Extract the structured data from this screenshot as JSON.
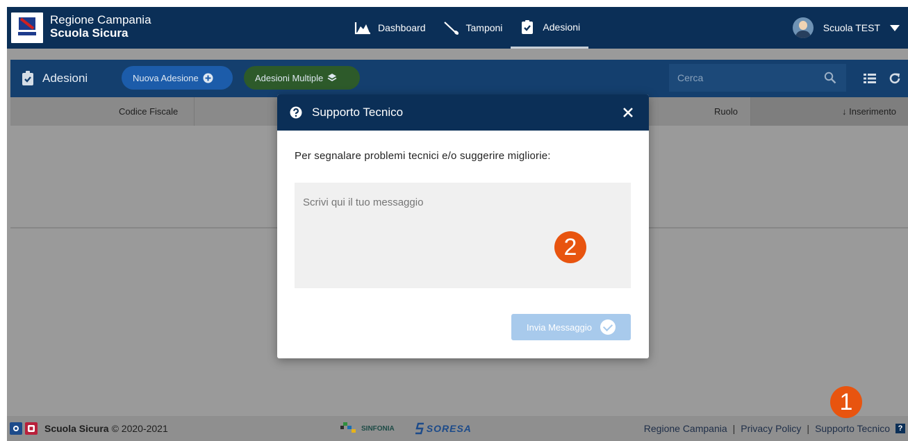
{
  "app": {
    "region": "Regione Campania",
    "name": "Scuola Sicura"
  },
  "nav": [
    {
      "label": "Dashboard",
      "icon": "area-chart-icon"
    },
    {
      "label": "Tamponi",
      "icon": "swab-icon"
    },
    {
      "label": "Adesioni",
      "icon": "clipboard-check-icon",
      "active": true
    }
  ],
  "user": {
    "name": "Scuola TEST"
  },
  "toolbar": {
    "title": "Adesioni",
    "new_button": "Nuova Adesione",
    "multiple_button": "Adesioni Multiple",
    "search_placeholder": "Cerca"
  },
  "table": {
    "columns": [
      "Codice Fiscale",
      "Ruolo",
      "↓ Inserimento"
    ]
  },
  "modal": {
    "title": "Supporto Tecnico",
    "prompt": "Per segnalare problemi tecnici e/o suggerire migliorie:",
    "message_placeholder": "Scrivi qui il tuo messaggio",
    "send_button": "Invia Messaggio"
  },
  "footer": {
    "brand": "Scuola Sicura",
    "copyright": "© 2020-2021",
    "partner1": "SINFONIA",
    "partner2": "SORESA",
    "links": [
      "Regione Campania",
      "Privacy Policy",
      "Supporto Tecnico"
    ],
    "separator": "|",
    "help_glyph": "?"
  },
  "annotations": [
    "1",
    "2"
  ],
  "colors": {
    "header": "#0b2f57",
    "toolbar": "#143f6e",
    "blue_pill": "#1c5caa",
    "green_pill": "#2d5a2a",
    "badge": "#e8540f",
    "send_button": "#a8caec"
  }
}
